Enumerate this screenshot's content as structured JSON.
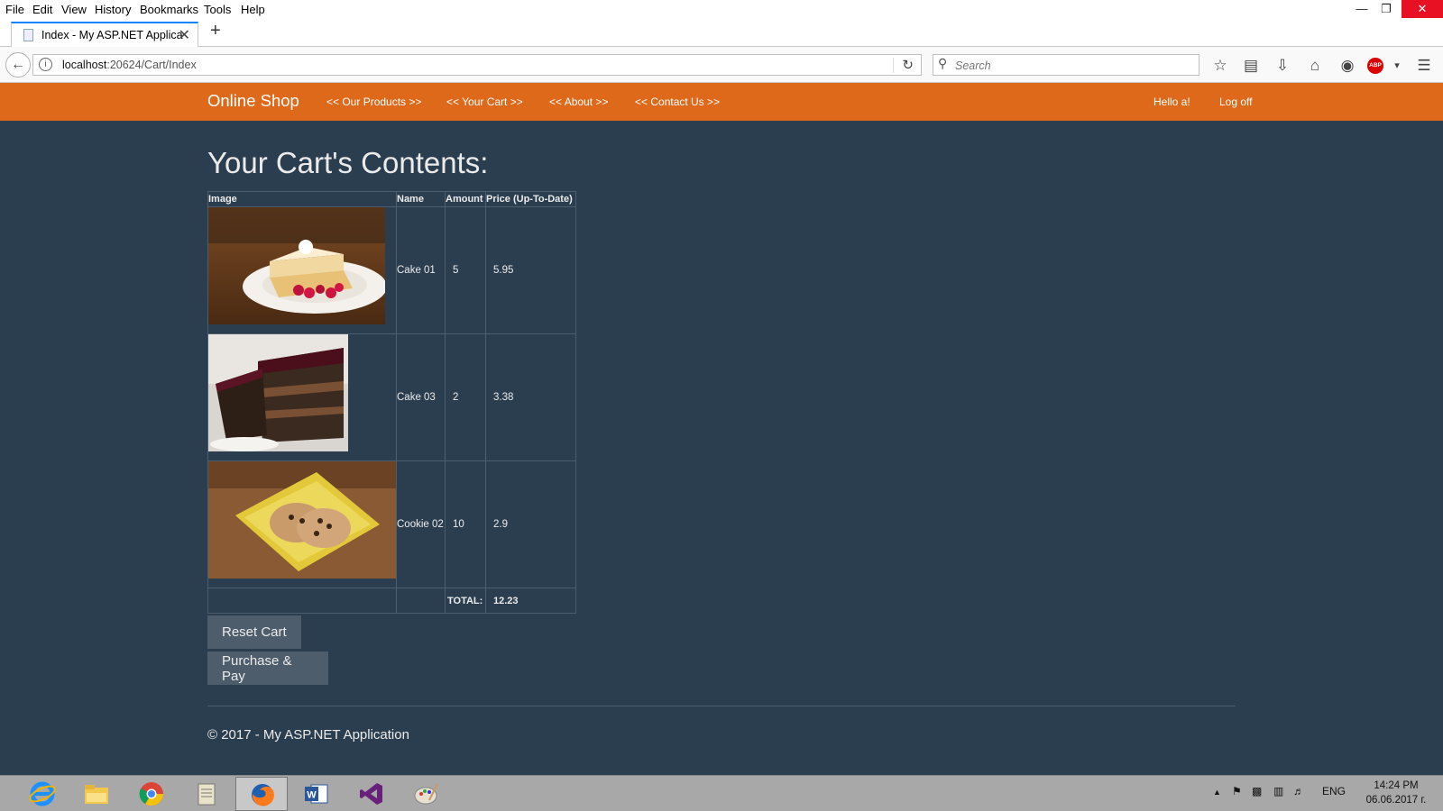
{
  "browser": {
    "menu": [
      "File",
      "Edit",
      "View",
      "History",
      "Bookmarks",
      "Tools",
      "Help"
    ],
    "tab_title": "Index - My ASP.NET Applica",
    "url_host": "localhost",
    "url_rest": ":20624/Cart/Index",
    "search_placeholder": "Search"
  },
  "site": {
    "brand": "Online Shop",
    "nav": [
      "<< Our Products >>",
      "<< Your Cart >>",
      "<< About >>",
      "<< Contact Us >>"
    ],
    "greeting": "Hello a!",
    "logoff": "Log off"
  },
  "cart": {
    "title": "Your Cart's Contents:",
    "headers": [
      "Image",
      "Name",
      "Amount",
      "Price (Up-To-Date)"
    ],
    "rows": [
      {
        "name": "Cake 01",
        "amount": "5",
        "price": "5.95"
      },
      {
        "name": "Cake 03",
        "amount": "2",
        "price": "3.38"
      },
      {
        "name": "Cookie 02",
        "amount": "10",
        "price": "2.9"
      }
    ],
    "total_label": "TOTAL:",
    "total_value": "12.23",
    "reset_label": "Reset Cart",
    "purchase_label": "Purchase & Pay"
  },
  "footer": "© 2017 - My ASP.NET Application",
  "taskbar": {
    "lang": "ENG",
    "time": "14:24 PM",
    "date": "06.06.2017 г."
  },
  "colors": {
    "navbar": "#df691a",
    "background": "#2b3e50",
    "button": "#4e5d6c"
  }
}
